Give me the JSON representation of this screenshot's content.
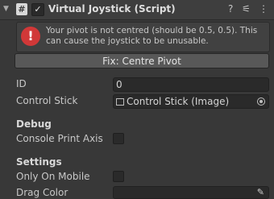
{
  "header": {
    "foldout_icon": "▼",
    "script_icon_glyph": "#",
    "enabled_check": "✓",
    "title": "Virtual Joystick (Script)",
    "help_icon": "?",
    "presets_icon": "⚟",
    "menu_icon": "⋮"
  },
  "warning": {
    "icon": "!",
    "text": "Your pivot is not centred (should be 0.5, 0.5). This can cause the joystick to be unusable.",
    "fix_button": "Fix: Centre Pivot"
  },
  "fields": {
    "id_label": "ID",
    "id_value": "0",
    "control_stick_label": "Control Stick",
    "control_stick_value": "Control Stick (Image)"
  },
  "debug": {
    "section_title": "Debug",
    "console_print_axis_label": "Console Print Axis",
    "console_print_axis_checked": false
  },
  "settings": {
    "section_title": "Settings",
    "only_on_mobile_label": "Only On Mobile",
    "only_on_mobile_checked": false,
    "drag_color_label": "Drag Color",
    "eyedropper_icon": "✎"
  }
}
